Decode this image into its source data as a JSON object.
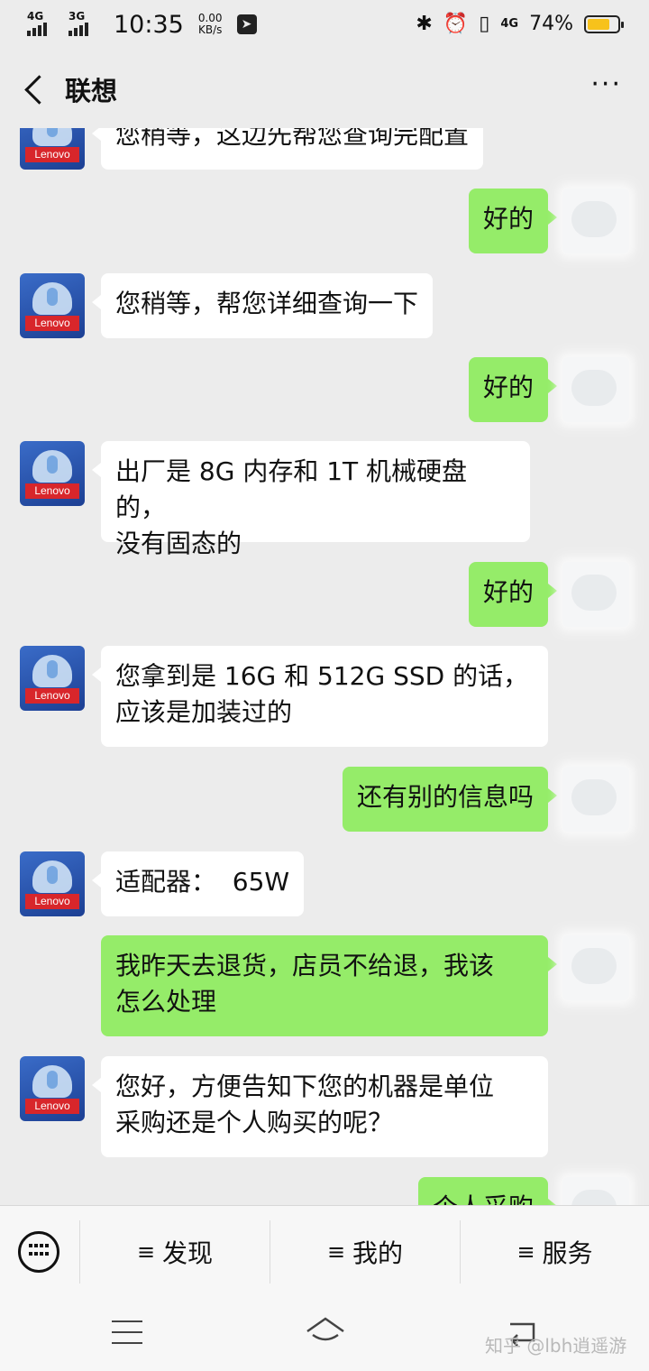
{
  "status_bar": {
    "sim1": "4G",
    "sim2": "3G",
    "time": "10:35",
    "net_speed_value": "0.00",
    "net_speed_unit": "KB/s",
    "network_right": "4G",
    "battery_text": "74%",
    "battery_level": 0.74
  },
  "header": {
    "title": "联想",
    "more_label": "···"
  },
  "avatar": {
    "brand": "Lenovo"
  },
  "messages": [
    {
      "side": "left",
      "text": "您稍等，这边先帮您查询完配置"
    },
    {
      "side": "right",
      "text": "好的"
    },
    {
      "side": "left",
      "text": "您稍等，帮您详细查询一下"
    },
    {
      "side": "right",
      "text": "好的"
    },
    {
      "side": "left",
      "text": "出厂是 8G 内存和 1T 机械硬盘的，\n没有固态的"
    },
    {
      "side": "right",
      "text": "好的"
    },
    {
      "side": "left",
      "text": "您拿到是 16G 和 512G SSD 的话，\n应该是加装过的"
    },
    {
      "side": "right",
      "text": "还有别的信息吗"
    },
    {
      "side": "left",
      "text": "适配器：  65W"
    },
    {
      "side": "right",
      "text": "我昨天去退货，店员不给退，我该\n怎么处理"
    },
    {
      "side": "left",
      "text": "您好，方便告知下您的机器是单位\n采购还是个人购买的呢？"
    },
    {
      "side": "right",
      "text": "个人采购"
    }
  ],
  "bottom_menu": {
    "items": [
      {
        "icon": "≡",
        "label": "发现"
      },
      {
        "icon": "≡",
        "label": "我的"
      },
      {
        "icon": "≡",
        "label": "服务"
      }
    ]
  },
  "watermark": "知乎 @lbh逍遥游"
}
